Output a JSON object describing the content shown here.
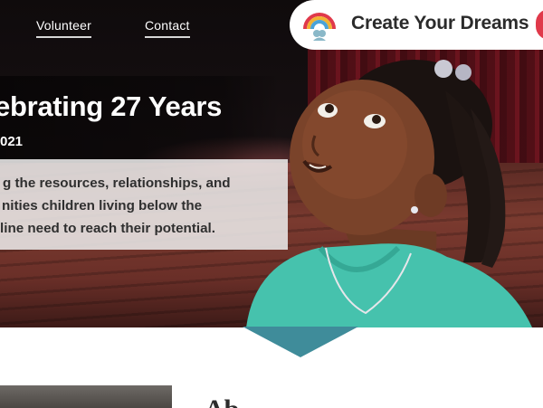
{
  "nav": {
    "links": [
      {
        "label": "Volunteer"
      },
      {
        "label": "Contact"
      }
    ]
  },
  "brand": {
    "name": "Create Your Dreams",
    "logo_icon": "rainbow-logo-icon"
  },
  "hero": {
    "title": "ebrating 27 Years",
    "year_line": "021",
    "description_lines": [
      "g the resources, relationships, and",
      "nities children living below the",
      "line need to reach their potential."
    ]
  },
  "lower": {
    "heading": "Ab"
  },
  "colors": {
    "accent_teal": "#3f8c9a",
    "logo_red": "#e0394a",
    "text_dark": "#2b2b2b"
  }
}
